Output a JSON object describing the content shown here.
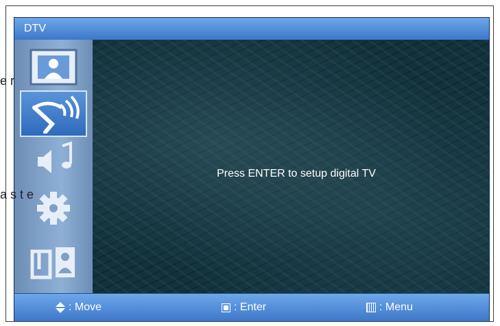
{
  "window": {
    "title": "DTV"
  },
  "sidebar": {
    "items": [
      {
        "icon": "picture-icon",
        "selected": false
      },
      {
        "icon": "antenna-icon",
        "selected": true
      },
      {
        "icon": "sound-icon",
        "selected": false
      },
      {
        "icon": "gear-icon",
        "selected": false
      },
      {
        "icon": "input-icon",
        "selected": false
      }
    ]
  },
  "main": {
    "message": "Press ENTER to setup digital TV"
  },
  "footer": {
    "move_label": ": Move",
    "enter_label": ": Enter",
    "menu_label": ": Menu"
  },
  "overlay_text": {
    "left_top": "e r",
    "left_middle": "a s t e"
  }
}
